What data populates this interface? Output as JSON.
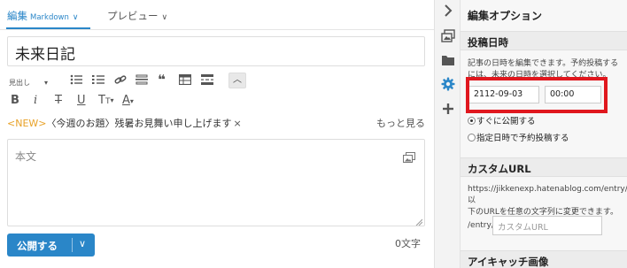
{
  "tabs": {
    "edit_label": "編集",
    "edit_sub": "Markdown",
    "preview_label": "プレビュー",
    "chevron": "∨"
  },
  "title": {
    "value": "未来日記"
  },
  "toolbar": {
    "heading_label": "見出し",
    "heading_caret": "▾",
    "bold": "B",
    "italic": "i",
    "strike": "T",
    "underline": "U",
    "font_size": "T",
    "font_size_sub": "T",
    "color": "A",
    "color_caret": "▾",
    "quote": "❝",
    "collapse": "︿"
  },
  "topic": {
    "new_badge": "<NEW>",
    "text": "〈今週のお題〉残暑お見舞い申し上げます",
    "close": "×",
    "more": "もっと見る"
  },
  "body": {
    "placeholder": "本文"
  },
  "footer": {
    "publish_label": "公開する",
    "publish_caret": "∨",
    "char_count": "0文字"
  },
  "rail": {
    "icons": [
      "chevron-right-icon",
      "images-icon",
      "folder-icon",
      "gear-icon",
      "plus-icon"
    ],
    "active_color": "#2a86c8"
  },
  "options": {
    "panel_title": "編集オプション",
    "post_date": {
      "header": "投稿日時",
      "desc_line1": "記事の日時を編集できます。予約投稿する",
      "desc_line2": "には、未来の日時を選択してください。",
      "date_value": "2112-09-03",
      "time_value": "00:00",
      "radio_now": "すぐに公開する",
      "radio_scheduled": "指定日時で予約投稿する",
      "selected": "now"
    },
    "custom_url": {
      "header": "カスタムURL",
      "desc_line1": "https://jikkenexp.hatenablog.com/entry/以",
      "desc_line2": "下のURLを任意の文字列に変更できます。",
      "prefix": "/entry/",
      "placeholder": "カスタムURL"
    },
    "eyecatch": {
      "header": "アイキャッチ画像"
    }
  },
  "colors": {
    "accent": "#2a86c8",
    "highlight_box": "#e0171e",
    "topic_new": "#e8a228"
  }
}
